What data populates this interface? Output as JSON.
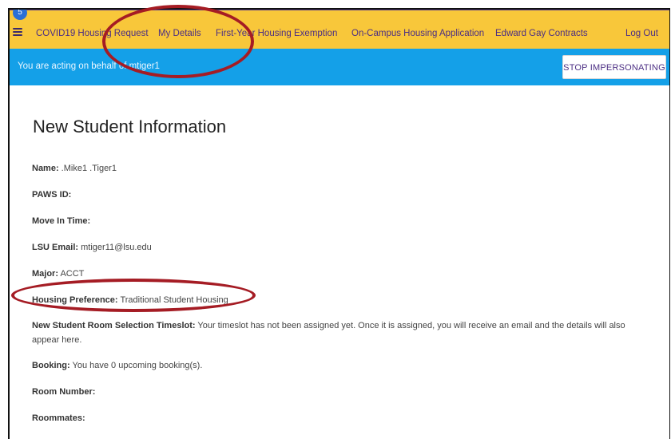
{
  "nav": {
    "badge_count": "5",
    "items": [
      {
        "label": "COVID19 Housing Request"
      },
      {
        "label": "My Details"
      },
      {
        "label": "First-Year Housing Exemption"
      },
      {
        "label": "On-Campus Housing Application"
      },
      {
        "label": "Edward Gay Contracts"
      },
      {
        "label": "Log Out"
      }
    ]
  },
  "impersonation": {
    "message": "You are acting on behalf of mtiger1",
    "stop_label": "STOP IMPERSONATING"
  },
  "page": {
    "title": "New Student Information",
    "fields": [
      {
        "label": "Name:",
        "value": " .Mike1 .Tiger1"
      },
      {
        "label": "PAWS ID:",
        "value": ""
      },
      {
        "label": "Move In Time:",
        "value": ""
      },
      {
        "label": "LSU Email:",
        "value": " mtiger11@lsu.edu"
      },
      {
        "label": "Major:",
        "value": " ACCT"
      },
      {
        "label": "Housing Preference:",
        "value": " Traditional Student Housing"
      },
      {
        "label": "New Student Room Selection Timeslot:",
        "value": " Your timeslot has not been assigned yet. Once it is assigned, you will receive an email and the details will also appear here."
      },
      {
        "label": "Booking:",
        "value": " You have 0 upcoming booking(s)."
      },
      {
        "label": "Room Number:",
        "value": ""
      },
      {
        "label": "Roommates:",
        "value": ""
      }
    ]
  },
  "colors": {
    "navbar": "#f8c73a",
    "nav_text": "#4b2e83",
    "impersonation_bar": "#14a0e8",
    "annotation": "#a51c24"
  }
}
